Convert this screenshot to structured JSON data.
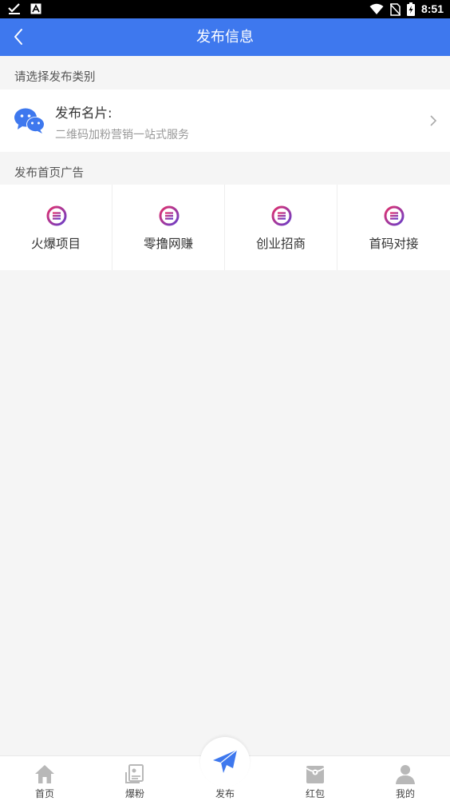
{
  "status_bar": {
    "time": "8:51"
  },
  "header": {
    "title": "发布信息"
  },
  "section1": {
    "label": "请选择发布类别"
  },
  "card": {
    "title": "发布名片:",
    "subtitle": "二维码加粉营销一站式服务"
  },
  "section2": {
    "label": "发布首页广告"
  },
  "ad_items": [
    {
      "label": "火爆项目"
    },
    {
      "label": "零撸网赚"
    },
    {
      "label": "创业招商"
    },
    {
      "label": "首码对接"
    }
  ],
  "tabbar": {
    "items": [
      {
        "label": "首页",
        "icon": "home-icon"
      },
      {
        "label": "爆粉",
        "icon": "fans-icon"
      },
      {
        "label": "发布",
        "icon": "paper-plane-icon"
      },
      {
        "label": "红包",
        "icon": "red-packet-icon"
      },
      {
        "label": "我的",
        "icon": "user-icon"
      }
    ]
  },
  "colors": {
    "primary": "#3e78ee",
    "background": "#f5f5f5",
    "icon_gradient_start": "#e0316e",
    "icon_gradient_end": "#6a3ec8"
  }
}
